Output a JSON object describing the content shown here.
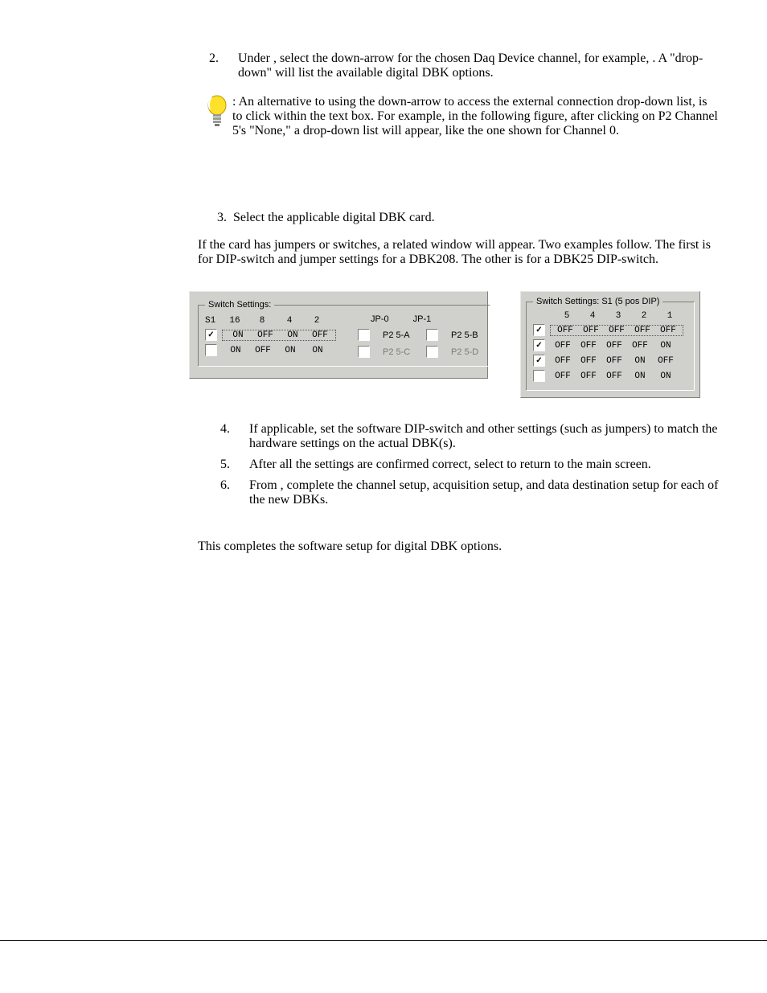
{
  "step2": {
    "n": "2.",
    "t1a": "Under ",
    "t1b": ", select the ",
    "t1c": " down-arrow for the chosen Daq Device channel, for example, ",
    "t1d": ".  A \"drop-down\" will list the available digital DBK options."
  },
  "tip": {
    "lead": ": An alternative to using the ",
    "mid": " down-arrow to access the external connection drop-down list, is to click within the text box.  For example, in the following figure, after clicking on P2 Channel 5's \"None,\" a drop-down list will appear, like the one shown for Channel 0."
  },
  "step3": {
    "n": "3.",
    "t": "Select the applicable digital DBK card."
  },
  "para1": "If the card has jumpers or switches, a related window will appear.  Two examples follow.  The first is for DIP-switch and jumper settings for a DBK208.  The other is for a DBK25 DIP-switch.",
  "panel208": {
    "legend": "Switch Settings:",
    "s1": "S1",
    "h": [
      "16",
      "8",
      "4",
      "2"
    ],
    "r1": {
      "checked": true,
      "v": [
        "ON",
        "OFF",
        "ON",
        "OFF"
      ]
    },
    "r2": {
      "checked": false,
      "v": [
        "ON",
        "OFF",
        "ON",
        "ON"
      ]
    },
    "jp0": "JP-0",
    "jp1": "JP-1",
    "rA": {
      "a_checked": false,
      "a": "P2 5-A",
      "b_checked": false,
      "b": "P2 5-B"
    },
    "rC": {
      "c_checked": false,
      "c": "P2 5-C",
      "d_checked": false,
      "d": "P2 5-D"
    }
  },
  "panel25": {
    "legend": "Switch Settings: S1 (5 pos DIP)",
    "h": [
      "5",
      "4",
      "3",
      "2",
      "1"
    ],
    "rows": [
      {
        "checked": true,
        "v": [
          "OFF",
          "OFF",
          "OFF",
          "OFF",
          "OFF"
        ]
      },
      {
        "checked": true,
        "v": [
          "OFF",
          "OFF",
          "OFF",
          "OFF",
          "ON"
        ]
      },
      {
        "checked": true,
        "v": [
          "OFF",
          "OFF",
          "OFF",
          "ON",
          "OFF"
        ]
      },
      {
        "checked": false,
        "v": [
          "OFF",
          "OFF",
          "OFF",
          "ON",
          "ON"
        ]
      }
    ]
  },
  "step4": {
    "n": "4.",
    "t": "If applicable, set the software DIP-switch and other settings (such as jumpers) to match the hardware settings on the actual DBK(s)."
  },
  "step5": {
    "n": "5.",
    "t1": "After all the settings are confirmed correct, select ",
    "t2": " to return to the ",
    "t3": " main screen."
  },
  "step6": {
    "n": "6.",
    "t1": "From ",
    "t2": ", complete the channel setup, acquisition setup, and data destination setup for each of the new DBKs."
  },
  "closing": "This completes the software setup for digital DBK options."
}
